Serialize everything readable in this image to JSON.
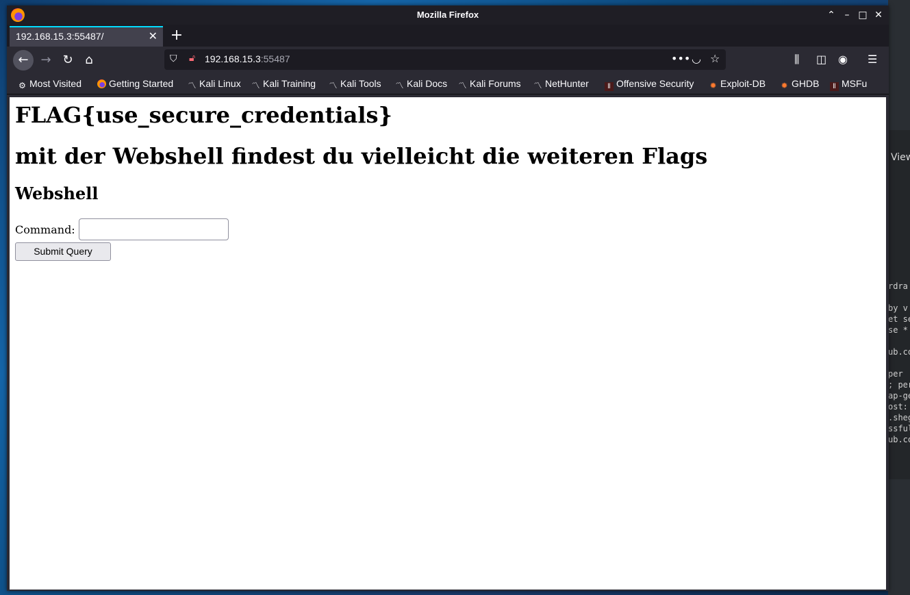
{
  "window": {
    "title": "Mozilla Firefox"
  },
  "tab": {
    "label": "192.168.15.3:55487/"
  },
  "url": {
    "host": "192.168.15.3",
    "port": ":55487"
  },
  "bookmarks": [
    {
      "label": "Most Visited",
      "icon": "gear-icon"
    },
    {
      "label": "Getting Started",
      "icon": "firefox-icon"
    },
    {
      "label": "Kali Linux",
      "icon": "kali-dragon-icon"
    },
    {
      "label": "Kali Training",
      "icon": "kali-dragon-icon"
    },
    {
      "label": "Kali Tools",
      "icon": "kali-dragon-icon"
    },
    {
      "label": "Kali Docs",
      "icon": "kali-dragon-icon"
    },
    {
      "label": "Kali Forums",
      "icon": "kali-dragon-icon"
    },
    {
      "label": "NetHunter",
      "icon": "kali-dragon-icon"
    },
    {
      "label": "Offensive Security",
      "icon": "offsec-icon"
    },
    {
      "label": "Exploit-DB",
      "icon": "exploitdb-icon"
    },
    {
      "label": "GHDB",
      "icon": "exploitdb-icon"
    },
    {
      "label": "MSFu",
      "icon": "offsec-icon"
    }
  ],
  "page": {
    "flag": "FLAG{use_secure_credentials}",
    "hint": "mit der Webshell findest du vielleicht die weiteren Flags",
    "webshell_heading": "Webshell",
    "command_label": "Command:",
    "command_value": "",
    "submit_label": "Submit Query"
  },
  "background": {
    "right_view_label": "View",
    "terminal_lines": [
      "rdra",
      "",
      "by v",
      "et se",
      "se *",
      "",
      "ub.co",
      "",
      "per",
      "; per",
      "ap-ge",
      "ost:",
      ".sheg",
      "ssful",
      "ub.co"
    ]
  },
  "colors": {
    "accent": "#00ddff",
    "toolbar": "#2b2a33",
    "tabbar": "#1c1b22"
  }
}
